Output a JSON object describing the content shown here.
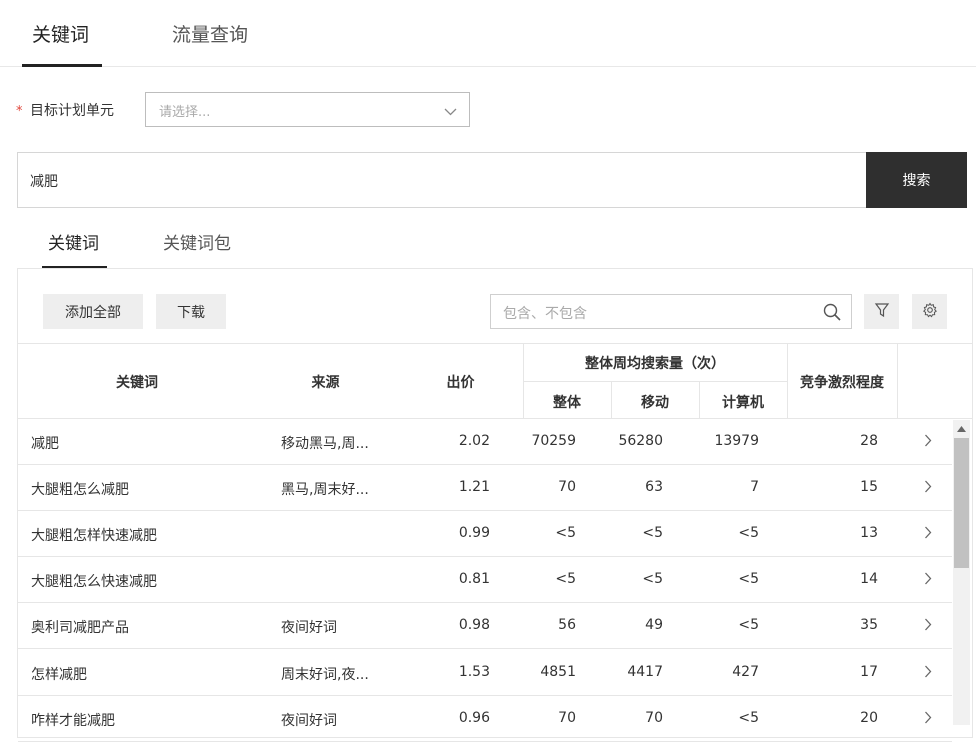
{
  "top_tabs": [
    {
      "label": "关键词"
    },
    {
      "label": "流量查询"
    }
  ],
  "target": {
    "label": "目标计划单元",
    "star": "*",
    "placeholder": "请选择..."
  },
  "search": {
    "keyword": "减肥",
    "button": "搜索"
  },
  "sub_tabs": [
    {
      "label": "关键词"
    },
    {
      "label": "关键词包"
    }
  ],
  "toolbar": {
    "add_all": "添加全部",
    "download": "下载",
    "filter_placeholder": "包含、不包含"
  },
  "table": {
    "headers": {
      "keyword": "关键词",
      "source": "来源",
      "bid": "出价",
      "weekly_group": "整体周均搜索量（次）",
      "overall": "整体",
      "mobile": "移动",
      "pc": "计算机",
      "competition": "竞争激烈程度"
    },
    "rows": [
      {
        "keyword": "减肥",
        "source": "移动黑马,周...",
        "bid": "2.02",
        "overall": "70259",
        "mobile": "56280",
        "pc": "13979",
        "competition": "28"
      },
      {
        "keyword": "大腿粗怎么减肥",
        "source": "黑马,周末好...",
        "bid": "1.21",
        "overall": "70",
        "mobile": "63",
        "pc": "7",
        "competition": "15"
      },
      {
        "keyword": "大腿粗怎样快速减肥",
        "source": "",
        "bid": "0.99",
        "overall": "<5",
        "mobile": "<5",
        "pc": "<5",
        "competition": "13"
      },
      {
        "keyword": "大腿粗怎么快速减肥",
        "source": "",
        "bid": "0.81",
        "overall": "<5",
        "mobile": "<5",
        "pc": "<5",
        "competition": "14"
      },
      {
        "keyword": "奥利司减肥产品",
        "source": "夜间好词",
        "bid": "0.98",
        "overall": "56",
        "mobile": "49",
        "pc": "<5",
        "competition": "35"
      },
      {
        "keyword": "怎样减肥",
        "source": "周末好词,夜...",
        "bid": "1.53",
        "overall": "4851",
        "mobile": "4417",
        "pc": "427",
        "competition": "17"
      },
      {
        "keyword": "咋样才能减肥",
        "source": "夜间好词",
        "bid": "0.96",
        "overall": "70",
        "mobile": "70",
        "pc": "<5",
        "competition": "20"
      }
    ]
  }
}
